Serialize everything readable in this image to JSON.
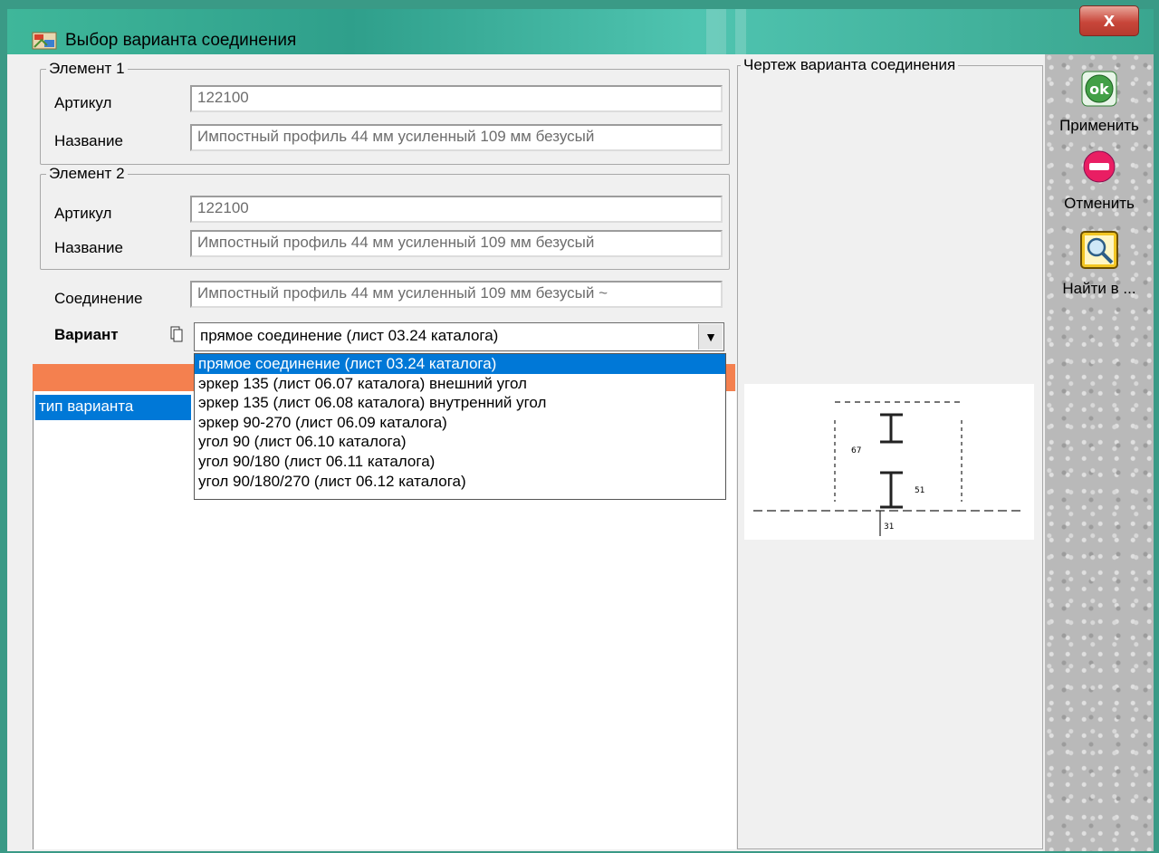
{
  "window": {
    "title": "Выбор варианта соединения",
    "close_glyph": "x"
  },
  "element1": {
    "group_title": "Элемент 1",
    "article_label": "Артикул",
    "article_value": "122100",
    "name_label": "Название",
    "name_value": "Импостный профиль 44 мм усиленный 109 мм безусый"
  },
  "element2": {
    "group_title": "Элемент 2",
    "article_label": "Артикул",
    "article_value": "122100",
    "name_label": "Название",
    "name_value": "Импостный профиль 44 мм усиленный 109 мм безусый"
  },
  "connection": {
    "label": "Соединение",
    "value": "Импостный профиль 44 мм усиленный 109 мм безусый ~"
  },
  "variant": {
    "label": "Вариант",
    "selected": "прямое соединение (лист 03.24 каталога)",
    "options": [
      "прямое соединение (лист 03.24 каталога)",
      "эркер 135 (лист 06.07 каталога) внешний угол",
      "эркер 135 (лист 06.08 каталога) внутренний угол",
      "эркер 90-270 (лист 06.09 каталога)",
      "угол 90 (лист 06.10 каталога)",
      "угол 90/180 (лист 06.11 каталога)",
      "угол 90/180/270 (лист 06.12 каталога)"
    ]
  },
  "tree": {
    "item": "тип варианта"
  },
  "drawing": {
    "title": "Чертеж варианта соединения",
    "labels": [
      "67",
      "51",
      "31"
    ]
  },
  "toolbar": {
    "apply_icon": "ok",
    "apply": "Применить",
    "cancel": "Отменить",
    "find": "Найти в ..."
  },
  "colors": {
    "selection": "#0078d7",
    "header_bar": "#f4804f",
    "title_bar": "#3fb79a"
  }
}
